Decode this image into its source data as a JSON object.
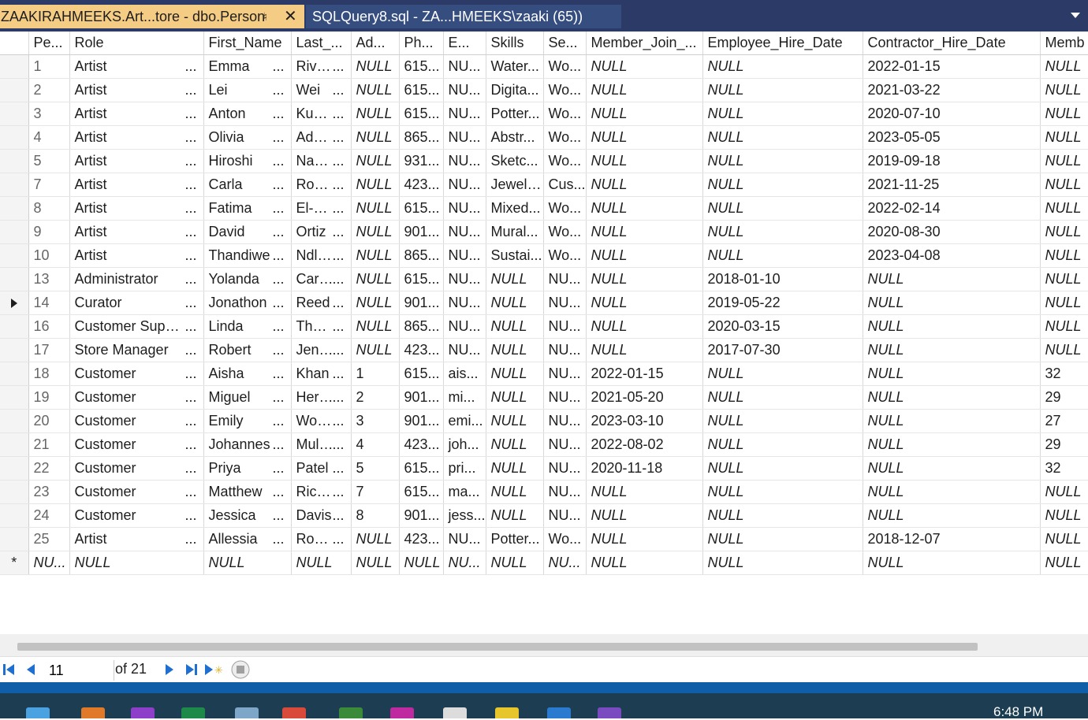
{
  "tabs": {
    "active_title": "ZAAKIRAHMEEKS.Art...tore - dbo.Person",
    "inactive_title": "SQLQuery8.sql - ZA...HMEEKS\\zaaki (65))"
  },
  "grid": {
    "columns": [
      "Pe...",
      "Role",
      "First_Name",
      "Last_...",
      "Ad...",
      "Ph...",
      "E...",
      "Skills",
      "Se...",
      "Member_Join_...",
      "Employee_Hire_Date",
      "Contractor_Hire_Date",
      "Memb"
    ],
    "current_row_index": 10,
    "rows": [
      [
        "1",
        "Artist",
        "Emma",
        "Rivera...",
        "NULL",
        "615...",
        "NU...",
        "Water...",
        "Wo...",
        "NULL",
        "NULL",
        "2022-01-15",
        "NULL"
      ],
      [
        "2",
        "Artist",
        "Lei",
        "Wei",
        "NULL",
        "615...",
        "NU...",
        "Digita...",
        "Wo...",
        "NULL",
        "NULL",
        "2021-03-22",
        "NULL"
      ],
      [
        "3",
        "Artist",
        "Anton",
        "Kuzne...",
        "NULL",
        "615...",
        "NU...",
        "Potter...",
        "Wo...",
        "NULL",
        "NULL",
        "2020-07-10",
        "NULL"
      ],
      [
        "4",
        "Artist",
        "Olivia",
        "Adeba...",
        "NULL",
        "865...",
        "NU...",
        "Abstr...",
        "Wo...",
        "NULL",
        "NULL",
        "2023-05-05",
        "NULL"
      ],
      [
        "5",
        "Artist",
        "Hiroshi",
        "Naka...",
        "NULL",
        "931...",
        "NU...",
        "Sketc...",
        "Wo...",
        "NULL",
        "NULL",
        "2019-09-18",
        "NULL"
      ],
      [
        "7",
        "Artist",
        "Carla",
        "Rodri...",
        "NULL",
        "423...",
        "NU...",
        "Jewelr...",
        "Cus...",
        "NULL",
        "NULL",
        "2021-11-25",
        "NULL"
      ],
      [
        "8",
        "Artist",
        "Fatima",
        "El-Has...",
        "NULL",
        "615...",
        "NU...",
        "Mixed...",
        "Wo...",
        "NULL",
        "NULL",
        "2022-02-14",
        "NULL"
      ],
      [
        "9",
        "Artist",
        "David",
        "Ortiz",
        "NULL",
        "901...",
        "NU...",
        "Mural...",
        "Wo...",
        "NULL",
        "NULL",
        "2020-08-30",
        "NULL"
      ],
      [
        "10",
        "Artist",
        "Thandiwe",
        "Ndlov...",
        "NULL",
        "865...",
        "NU...",
        "Sustai...",
        "Wo...",
        "NULL",
        "NULL",
        "2023-04-08",
        "NULL"
      ],
      [
        "13",
        "Administrator",
        "Yolanda",
        "Carter",
        "NULL",
        "615...",
        "NU...",
        "NULL",
        "NU...",
        "NULL",
        "2018-01-10",
        "NULL",
        "NULL"
      ],
      [
        "14",
        "Curator",
        "Jonathon",
        "Reed",
        "NULL",
        "901...",
        "NU...",
        "NULL",
        "NU...",
        "NULL",
        "2019-05-22",
        "NULL",
        "NULL"
      ],
      [
        "16",
        "Customer Suppor...",
        "Linda",
        "Thom...",
        "NULL",
        "865...",
        "NU...",
        "NULL",
        "NU...",
        "NULL",
        "2020-03-15",
        "NULL",
        "NULL"
      ],
      [
        "17",
        "Store Manager",
        "Robert",
        "Jenkin...",
        "NULL",
        "423...",
        "NU...",
        "NULL",
        "NU...",
        "NULL",
        "2017-07-30",
        "NULL",
        "NULL"
      ],
      [
        "18",
        "Customer",
        "Aisha",
        "Khan",
        "1",
        "615...",
        "ais...",
        "NULL",
        "NU...",
        "2022-01-15",
        "NULL",
        "NULL",
        "32"
      ],
      [
        "19",
        "Customer",
        "Miguel",
        "Herna...",
        "2",
        "901...",
        "mi...",
        "NULL",
        "NU...",
        "2021-05-20",
        "NULL",
        "NULL",
        "29"
      ],
      [
        "20",
        "Customer",
        "Emily",
        "Wong...",
        "3",
        "901...",
        "emi...",
        "NULL",
        "NU...",
        "2023-03-10",
        "NULL",
        "NULL",
        "27"
      ],
      [
        "21",
        "Customer",
        "Johannes",
        "Muller...",
        "4",
        "423...",
        "joh...",
        "NULL",
        "NU...",
        "2022-08-02",
        "NULL",
        "NULL",
        "29"
      ],
      [
        "22",
        "Customer",
        "Priya",
        "Patel",
        "5",
        "615...",
        "pri...",
        "NULL",
        "NU...",
        "2020-11-18",
        "NULL",
        "NULL",
        "32"
      ],
      [
        "23",
        "Customer",
        "Matthew",
        "Richar...",
        "7",
        "615...",
        "ma...",
        "NULL",
        "NU...",
        "NULL",
        "NULL",
        "NULL",
        "NULL"
      ],
      [
        "24",
        "Customer",
        "Jessica",
        "Davis",
        "8",
        "901...",
        "jess...",
        "NULL",
        "NU...",
        "NULL",
        "NULL",
        "NULL",
        "NULL"
      ],
      [
        "25",
        "Artist",
        "Allessia",
        "Roma...",
        "NULL",
        "423...",
        "NU...",
        "Potter...",
        "Wo...",
        "NULL",
        "NULL",
        "2018-12-07",
        "NULL"
      ]
    ],
    "new_row": {
      "marker": "*",
      "cells": [
        "NU...",
        "NULL",
        "NULL",
        "NULL",
        "NULL",
        "NULL",
        "NU...",
        "NULL",
        "NU...",
        "NULL",
        "NULL",
        "NULL",
        "NULL"
      ]
    },
    "null_text": "NULL",
    "ellipsis": "..."
  },
  "navigator": {
    "current_record": "11",
    "of_label": "of 21"
  },
  "taskbar": {
    "clock_time": "6:48 PM"
  },
  "colors": {
    "tab_active": "#f5cc84",
    "tab_strip": "#2b3a67",
    "nav_blue": "#1e6fd0",
    "taskbar": "#1d3d52"
  }
}
